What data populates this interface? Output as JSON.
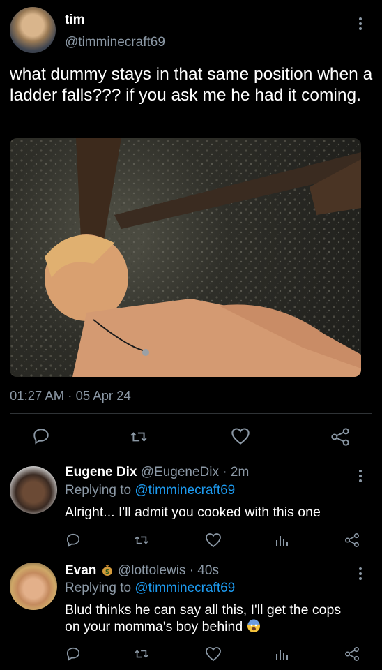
{
  "main_tweet": {
    "display_name": "tim",
    "handle": "@timminecraft69",
    "text": "what dummy stays in that same position when a ladder falls??? if you ask me he had it coming.",
    "timestamp": "01:27 AM · 05 Apr 24"
  },
  "actions": {
    "reply_icon": "reply-icon",
    "retweet_icon": "retweet-icon",
    "like_icon": "heart-icon",
    "share_icon": "share-icon",
    "views_icon": "views-icon"
  },
  "replies": [
    {
      "display_name": "Eugene Dix",
      "handle": "@EugeneDix",
      "time": " · 2m",
      "replying_prefix": "Replying to ",
      "replying_to": "@timminecraft69",
      "text": "Alright... I'll admit you cooked with this one"
    },
    {
      "display_name": "Evan",
      "badge_emoji": "money-bag-emoji",
      "handle": "@lottolewis",
      "time": " · 40s",
      "replying_prefix": "Replying to ",
      "replying_to": "@timminecraft69",
      "text_line1": "Blud thinks he can say all this, I'll get the cops",
      "text_line2": "on your momma's boy behind",
      "trailing_emoji": "fearful-face-emoji"
    }
  ],
  "colors": {
    "background": "#000000",
    "text": "#ffffff",
    "muted": "#8b98a5",
    "link": "#1d9bf0",
    "divider": "#2f3336"
  }
}
